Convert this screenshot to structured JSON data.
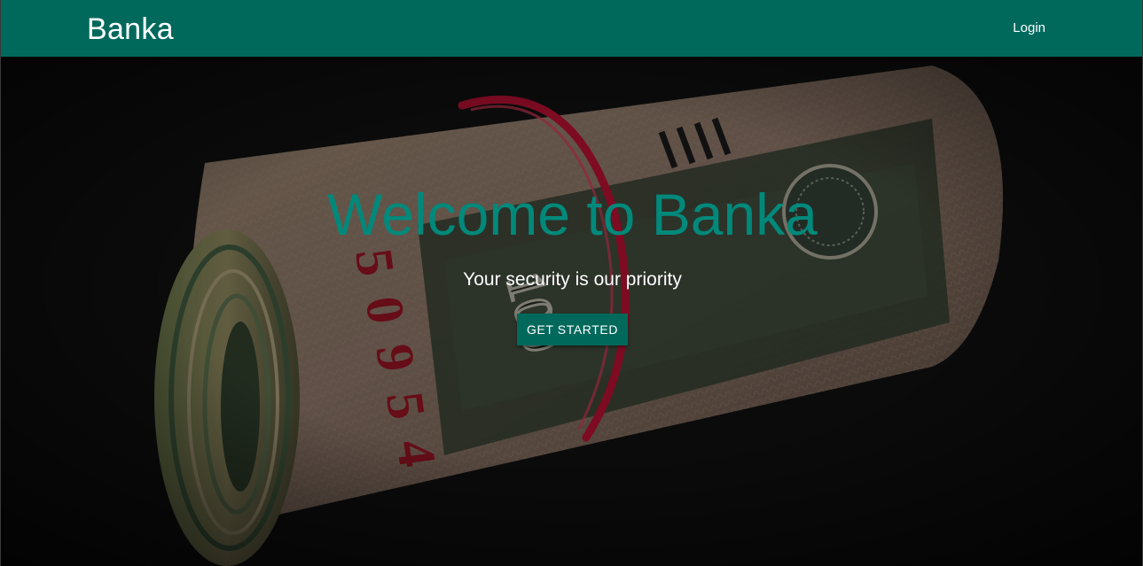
{
  "colors": {
    "primary": "#00695c",
    "accent": "#00897b",
    "text_on_primary": "#ffffff"
  },
  "navbar": {
    "brand": "Banka",
    "login_label": "Login"
  },
  "hero": {
    "title": "Welcome to Banka",
    "subtitle": "Your security is our priority",
    "cta_label": "GET STARTED"
  }
}
